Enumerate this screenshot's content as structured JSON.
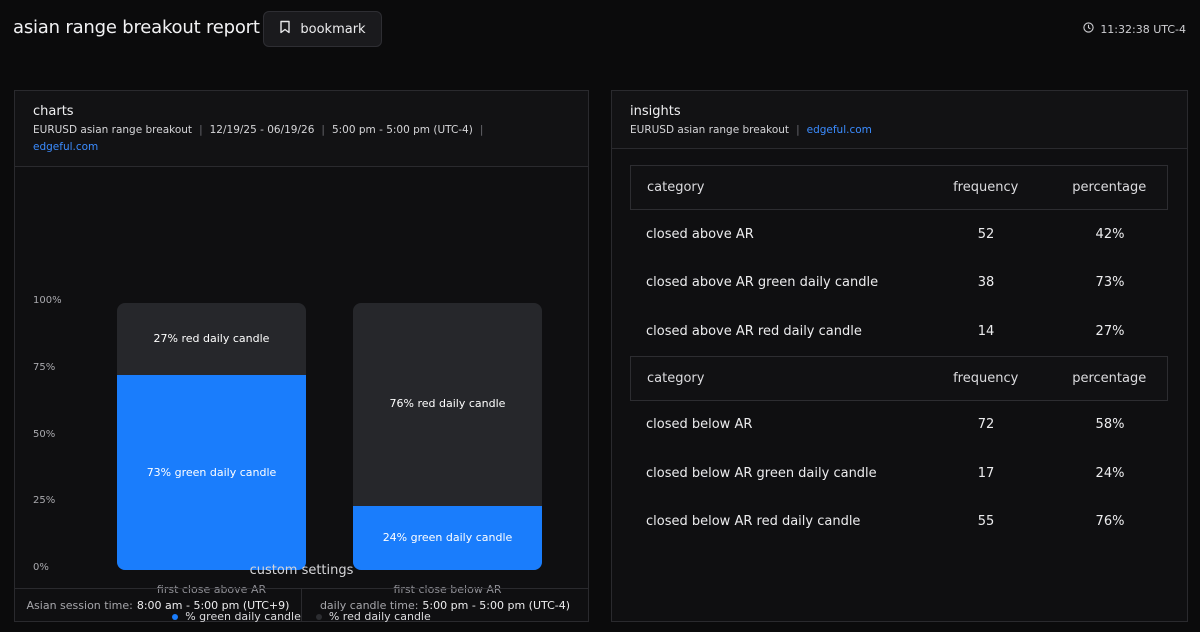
{
  "header": {
    "title": "asian range breakout report",
    "bookmark_label": "bookmark",
    "time": "11:32:38 UTC-4"
  },
  "charts_panel": {
    "title": "charts",
    "subtitle": {
      "instrument": "EURUSD asian range breakout",
      "date_range": "12/19/25 - 06/19/26",
      "session": "5:00 pm - 5:00 pm (UTC-4)",
      "link": "edgeful.com"
    },
    "custom_settings_title": "custom settings",
    "settings": [
      {
        "key": "Asian session time:",
        "value": "8:00 am - 5:00 pm (UTC+9)"
      },
      {
        "key": "daily candle time:",
        "value": "5:00 pm - 5:00 pm (UTC-4)"
      }
    ]
  },
  "chart_data": {
    "type": "bar",
    "stacked": true,
    "categories": [
      "first close above AR",
      "first close below AR"
    ],
    "series": [
      {
        "name": "% green daily candle",
        "values": [
          73,
          24
        ],
        "color": "#1a7dfc"
      },
      {
        "name": "% red daily candle",
        "values": [
          27,
          76
        ],
        "color": "#26272b"
      }
    ],
    "data_labels": [
      [
        "73% green daily candle",
        "27% red daily candle"
      ],
      [
        "24% green daily candle",
        "76% red daily candle"
      ]
    ],
    "yticks": [
      "100%",
      "75%",
      "50%",
      "25%",
      "0%"
    ],
    "ylim": [
      0,
      100
    ],
    "legend_position": "bottom"
  },
  "insights_panel": {
    "title": "insights",
    "subtitle": {
      "instrument": "EURUSD asian range breakout",
      "link": "edgeful.com"
    },
    "tables": [
      {
        "headers": [
          "category",
          "frequency",
          "percentage"
        ],
        "rows": [
          [
            "closed above AR",
            "52",
            "42%"
          ],
          [
            "closed above AR green daily candle",
            "38",
            "73%"
          ],
          [
            "closed above AR red daily candle",
            "14",
            "27%"
          ]
        ]
      },
      {
        "headers": [
          "category",
          "frequency",
          "percentage"
        ],
        "rows": [
          [
            "closed below AR",
            "72",
            "58%"
          ],
          [
            "closed below AR green daily candle",
            "17",
            "24%"
          ],
          [
            "closed below AR red daily candle",
            "55",
            "76%"
          ]
        ]
      }
    ]
  }
}
